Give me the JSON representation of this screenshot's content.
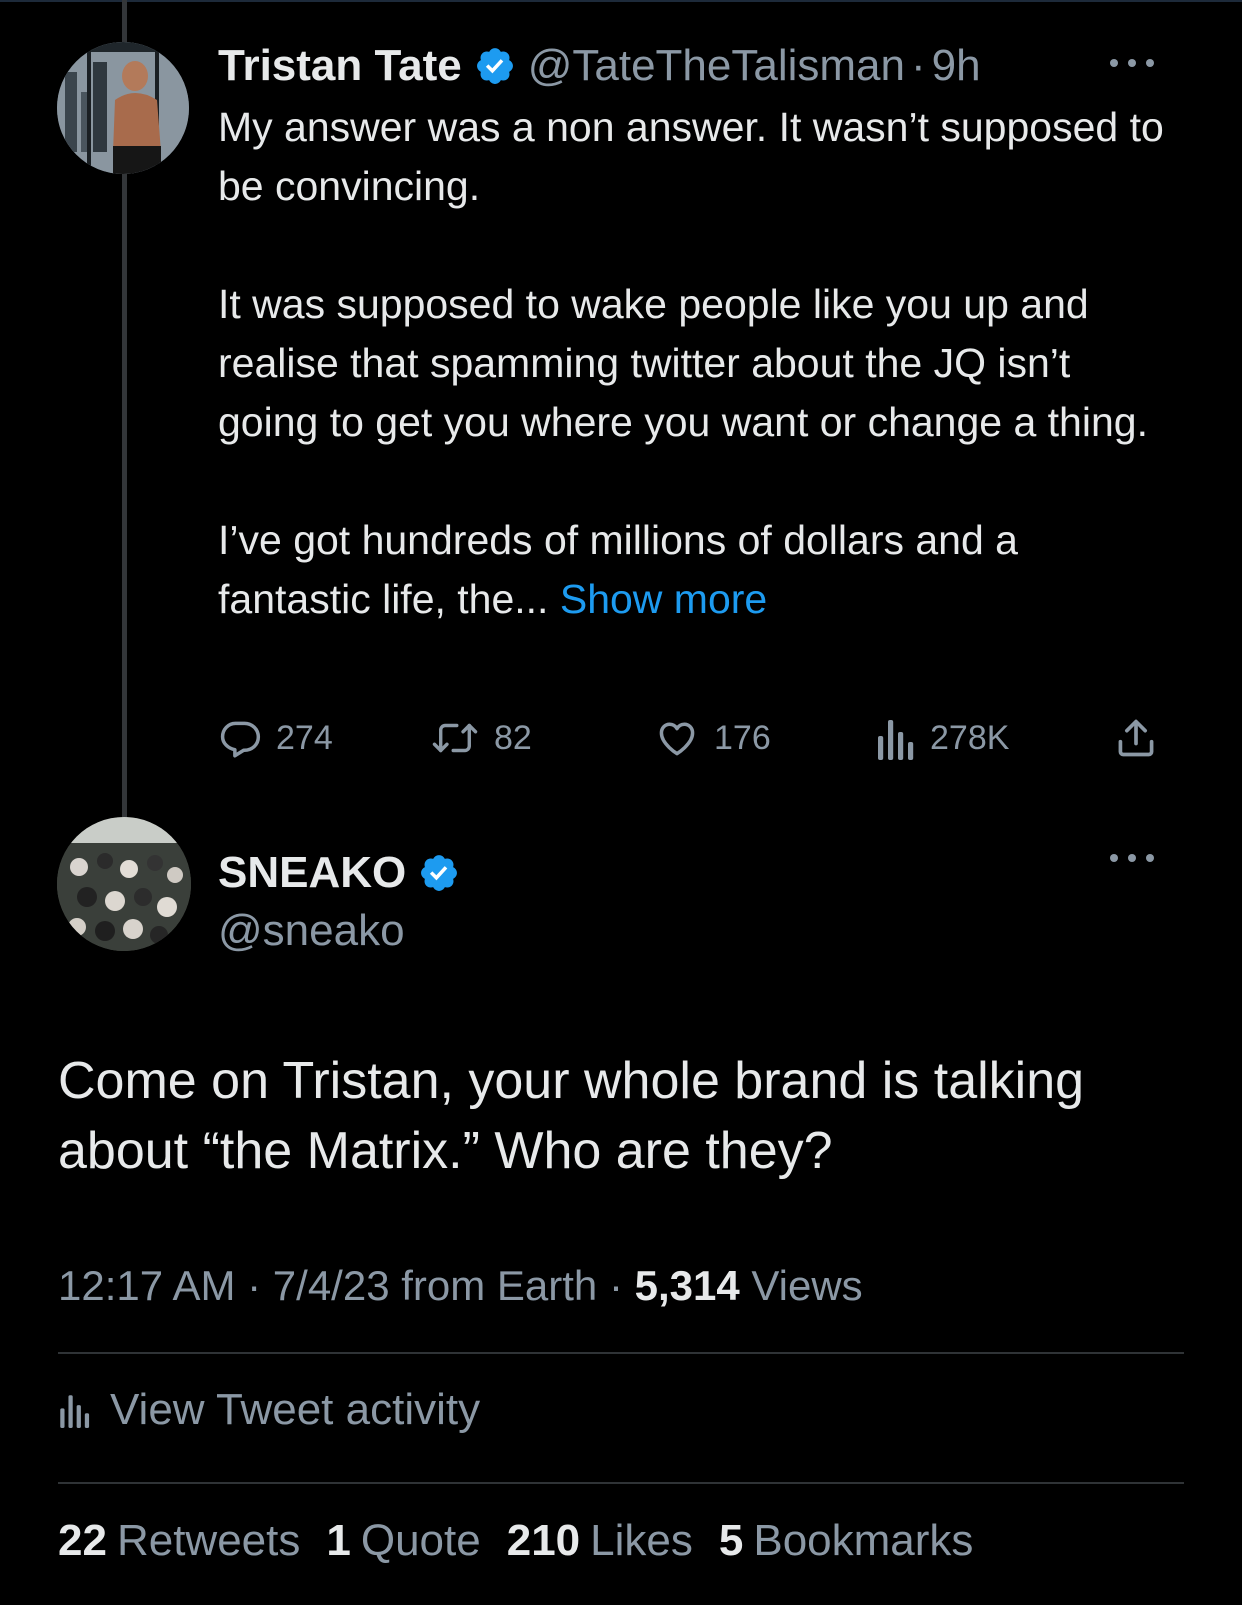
{
  "parent_tweet": {
    "author_name": "Tristan Tate",
    "handle": "@TateTheTalisman",
    "separator": "·",
    "time": "9h",
    "paragraphs": [
      "My answer was a non answer. It wasn’t supposed to be convincing.",
      "It was supposed to wake people like you up and realise that spamming twitter about the JQ isn’t going to get you where you want or change a thing."
    ],
    "last_paragraph": "I’ve got hundreds of millions of dollars and a fantastic life, the...",
    "show_more": "Show more",
    "actions": {
      "replies": "274",
      "retweets": "82",
      "likes": "176",
      "views": "278K"
    }
  },
  "main_tweet": {
    "author_name": "SNEAKO",
    "handle": "@sneako",
    "text": "Come on Tristan, your whole brand is talking about “the Matrix.” Who are they?",
    "meta": {
      "time": "12:17 AM",
      "separator1": " · ",
      "date_source": "7/4/23 from Earth",
      "separator2": " · ",
      "views_count": "5,314",
      "views_label": "Views"
    },
    "view_activity": "View Tweet activity",
    "stats": [
      {
        "count": "22",
        "label": "Retweets"
      },
      {
        "count": "1",
        "label": "Quote"
      },
      {
        "count": "210",
        "label": "Likes"
      },
      {
        "count": "5",
        "label": "Bookmarks"
      }
    ]
  },
  "colors": {
    "background": "#000000",
    "text": "#e7e9ea",
    "secondary": "#8b98a5",
    "accent": "#1d9bf0",
    "divider": "#2f3336"
  }
}
